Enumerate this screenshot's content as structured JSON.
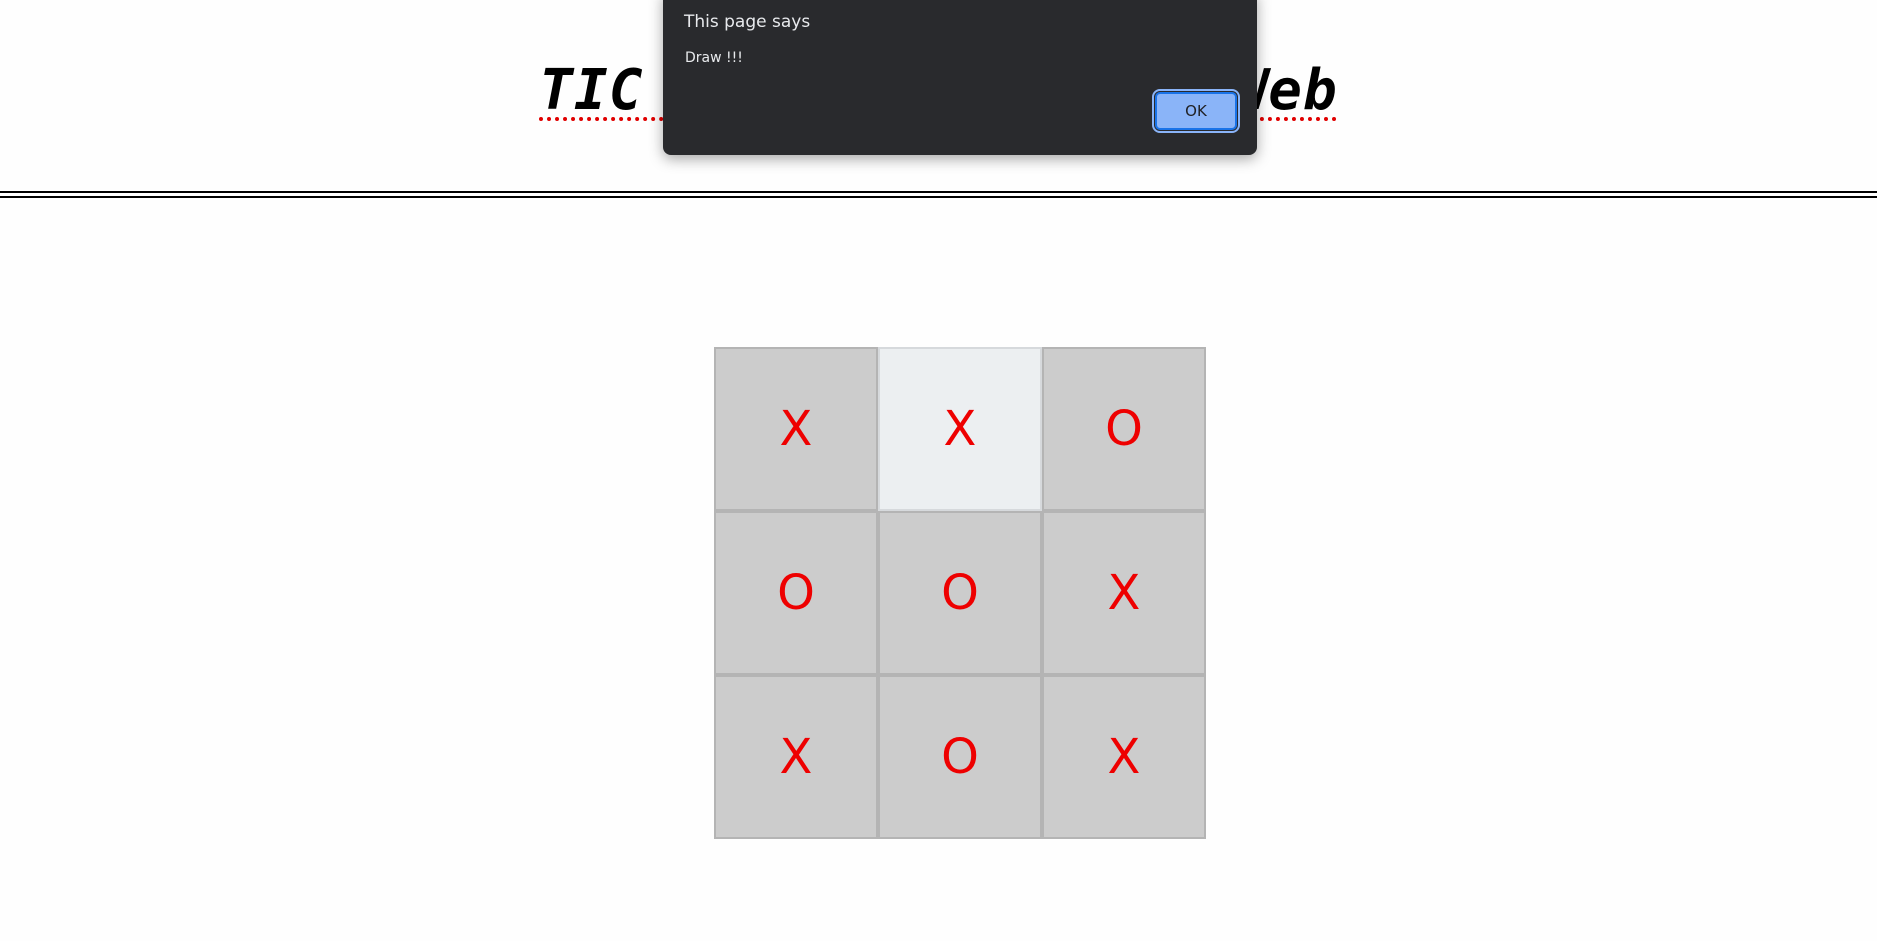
{
  "page": {
    "title": "TIC TAC TOE Game in Web"
  },
  "board": {
    "cells": [
      "X",
      "X",
      "O",
      "O",
      "O",
      "X",
      "X",
      "O",
      "X"
    ],
    "highlighted_index": 1,
    "mark_color": "#ee0000",
    "cell_color": "#cccccc",
    "highlight_color": "#eceff1"
  },
  "alert": {
    "title": "This page says",
    "message": "Draw !!!",
    "ok_label": "OK",
    "background": "#292a2d",
    "button_color": "#8ab4f8"
  }
}
